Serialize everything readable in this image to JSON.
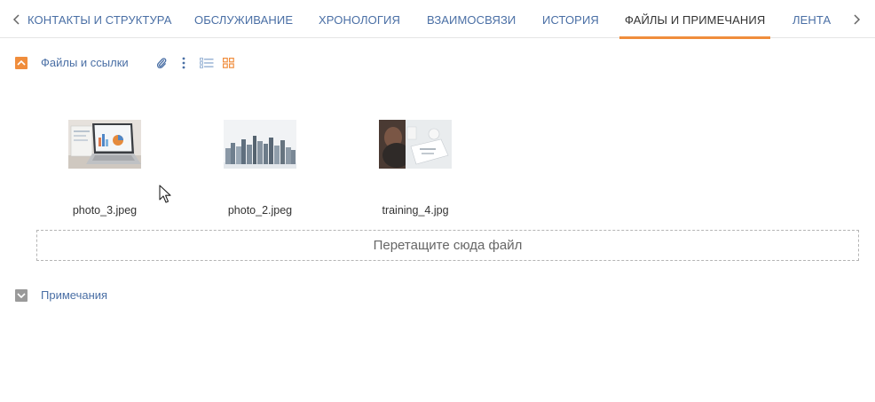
{
  "tabs": {
    "items": [
      {
        "label": "КОНТАКТЫ И СТРУКТУРА"
      },
      {
        "label": "ОБСЛУЖИВАНИЕ"
      },
      {
        "label": "ХРОНОЛОГИЯ"
      },
      {
        "label": "ВЗАИМОСВЯЗИ"
      },
      {
        "label": "ИСТОРИЯ"
      },
      {
        "label": "ФАЙЛЫ И ПРИМЕЧАНИЯ"
      },
      {
        "label": "ЛЕНТА"
      }
    ],
    "active": "ФАЙЛЫ И ПРИМЕЧАНИЯ"
  },
  "files_section": {
    "title": "Файлы и ссылки",
    "files": [
      {
        "name": "photo_3.jpeg"
      },
      {
        "name": "photo_2.jpeg"
      },
      {
        "name": "training_4.jpg"
      }
    ],
    "dropzone_text": "Перетащите сюда файл"
  },
  "notes_section": {
    "title": "Примечания"
  },
  "colors": {
    "accent": "#f08d3c",
    "link": "#4a6fa5"
  }
}
